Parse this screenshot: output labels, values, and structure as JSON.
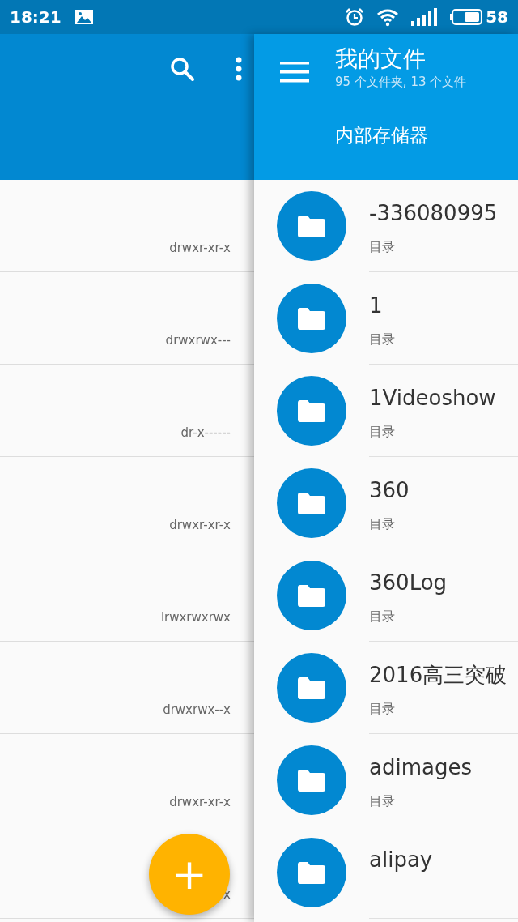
{
  "status_bar": {
    "time": "18:21",
    "battery": "58"
  },
  "left_list": {
    "rows": [
      {
        "permissions": "drwxr-xr-x"
      },
      {
        "permissions": "drwxrwx---"
      },
      {
        "permissions": "dr-x------"
      },
      {
        "permissions": "drwxr-xr-x"
      },
      {
        "permissions": "lrwxrwxrwx"
      },
      {
        "permissions": "drwxrwx--x"
      },
      {
        "permissions": "drwxr-xr-x"
      },
      {
        "permissions": "x"
      }
    ]
  },
  "fab": {
    "label": "+"
  },
  "drawer": {
    "title": "我的文件",
    "subtitle": "95 个文件夹, 13 个文件",
    "section": "内部存储器",
    "items": [
      {
        "name": "-336080995",
        "type": "目录"
      },
      {
        "name": "1",
        "type": "目录"
      },
      {
        "name": "1Videoshow",
        "type": "目录"
      },
      {
        "name": "360",
        "type": "目录"
      },
      {
        "name": "360Log",
        "type": "目录"
      },
      {
        "name": "2016高三突破",
        "type": "目录"
      },
      {
        "name": "adimages",
        "type": "目录"
      },
      {
        "name": "alipay"
      }
    ]
  }
}
